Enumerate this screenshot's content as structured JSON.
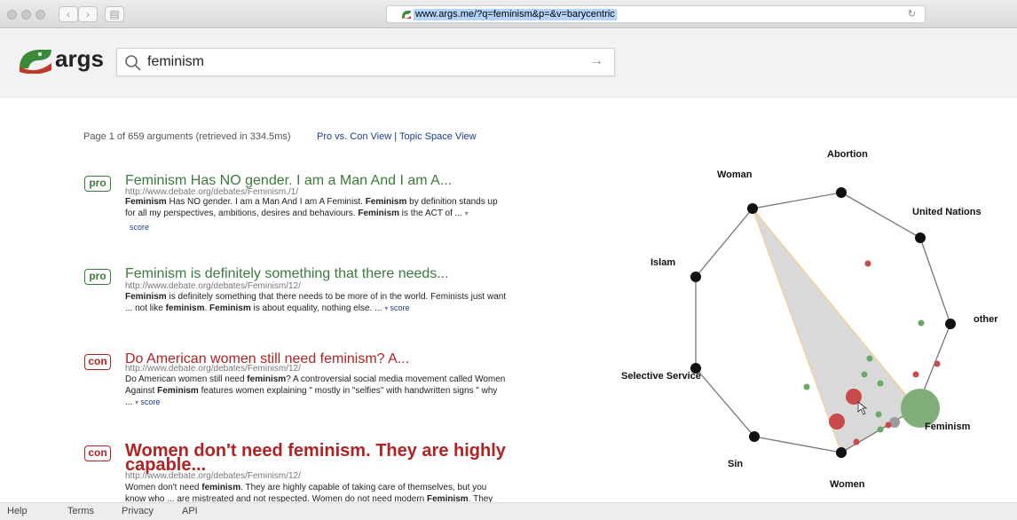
{
  "browser": {
    "url": "www.args.me/?q=feminism&p=&v=barycentric"
  },
  "brand": {
    "name": "args",
    "colors": {
      "green": "#3a8a3a",
      "red": "#c0392b",
      "pro": "#3c7a3c",
      "con": "#b22222",
      "link": "#1a3d8f"
    }
  },
  "search": {
    "value": "feminism",
    "arrow": "→"
  },
  "results_meta": {
    "summary": "Page 1 of 659 arguments (retrieved in 334.5ms)",
    "view_pro_con": "Pro vs. Con View",
    "separator": "|",
    "view_topic": "Topic Space View"
  },
  "results": [
    {
      "stance": "pro",
      "title": "Feminism Has NO gender. I am a Man And I am A...",
      "url": "http://www.debate.org/debates/Feminism./1/",
      "snippet": [
        {
          "t": "Feminism",
          "b": true
        },
        {
          "t": " Has NO gender. I am a Man And I am A Feminist. ",
          "b": false
        },
        {
          "t": "Feminism",
          "b": true
        },
        {
          "t": " by definition stands up for all my perspectives, ambitions, desires and behaviours. ",
          "b": false
        },
        {
          "t": "Feminism",
          "b": true
        },
        {
          "t": " is the ACT of ... ",
          "b": false
        }
      ],
      "score_label": "score"
    },
    {
      "stance": "pro",
      "title": "Feminism is definitely something that there needs...",
      "url": "http://www.debate.org/debates/Feminism/12/",
      "snippet": [
        {
          "t": "Feminism",
          "b": true
        },
        {
          "t": " is definitely something that there needs to be more of in the world. Feminists just want ... not like ",
          "b": false
        },
        {
          "t": "feminism",
          "b": true
        },
        {
          "t": ". ",
          "b": false
        },
        {
          "t": "Feminism",
          "b": true
        },
        {
          "t": " is about equality, nothing else. ... ",
          "b": false
        }
      ],
      "score_label": "score"
    },
    {
      "stance": "con",
      "title": "Do American women still need feminism? A...",
      "url": "http://www.debate.org/debates/Feminism/12/",
      "snippet": [
        {
          "t": "Do American women still need ",
          "b": false
        },
        {
          "t": "feminism",
          "b": true
        },
        {
          "t": "? A controversial social media movement called Women Against ",
          "b": false
        },
        {
          "t": "Feminism",
          "b": true
        },
        {
          "t": " features women explaining \" mostly in \"selfies\" with handwritten signs \" why ... ",
          "b": false
        }
      ],
      "score_label": "score"
    },
    {
      "stance": "con",
      "title": "Women don't need feminism. They are highly capable...",
      "url": "http://www.debate.org/debates/Feminism/12/",
      "snippet": [
        {
          "t": "Women don't need ",
          "b": false
        },
        {
          "t": "feminism",
          "b": true
        },
        {
          "t": ". They are highly capable of taking care of themselves, but you know who ... are mistreated and not respected. Women do not need modern ",
          "b": false
        },
        {
          "t": "Feminism",
          "b": true
        },
        {
          "t": ". They",
          "b": false
        }
      ],
      "score_label": ""
    }
  ],
  "graph": {
    "topics": [
      "Abortion",
      "United Nations",
      "other",
      "Feminism",
      "Women",
      "Sin",
      "Selective Service",
      "Islam",
      "Woman"
    ],
    "dots": [
      {
        "stance": "pro",
        "size": "large"
      },
      {
        "stance": "con",
        "size": "medium"
      },
      {
        "stance": "con",
        "size": "medium"
      },
      {
        "stance": "neutral",
        "size": "small"
      }
    ]
  },
  "footer": {
    "links": [
      "Help",
      "Terms",
      "Privacy",
      "API"
    ]
  }
}
